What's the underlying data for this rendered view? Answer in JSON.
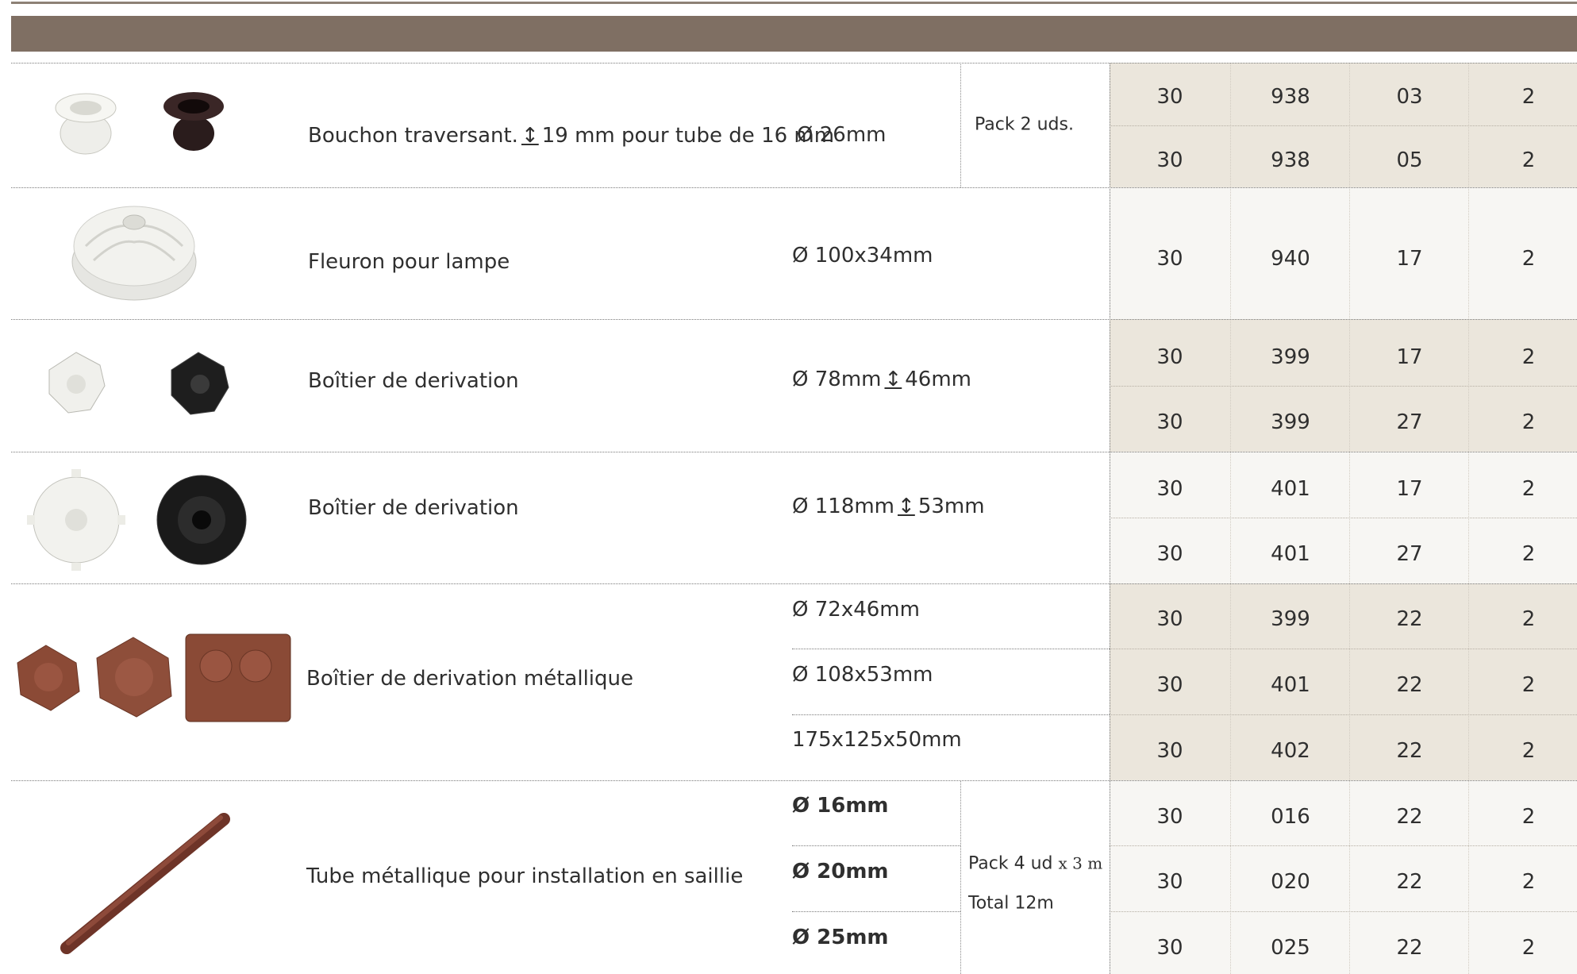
{
  "colors": {
    "band": "#7f6f63",
    "shaded_row": "#ebe6dc"
  },
  "rows": [
    {
      "description": "Bouchon traversant.",
      "height_icon": "height-arrow-icon",
      "description_suffix": "19 mm pour tube de 16 mm",
      "dimension": "Ø 26mm",
      "pack": "Pack 2 uds.",
      "codes": [
        [
          "30",
          "938",
          "03",
          "2"
        ],
        [
          "30",
          "938",
          "05",
          "2"
        ]
      ]
    },
    {
      "description": "Fleuron pour lampe",
      "dimension": "Ø 100x34mm",
      "codes": [
        [
          "30",
          "940",
          "17",
          "2"
        ]
      ]
    },
    {
      "description": "Boîtier de derivation",
      "dimension_prefix": "Ø 78mm",
      "dimension_suffix": "46mm",
      "codes": [
        [
          "30",
          "399",
          "17",
          "2"
        ],
        [
          "30",
          "399",
          "27",
          "2"
        ]
      ]
    },
    {
      "description": "Boîtier de derivation",
      "dimension_prefix": "Ø 118mm",
      "dimension_suffix": "53mm",
      "codes": [
        [
          "30",
          "401",
          "17",
          "2"
        ],
        [
          "30",
          "401",
          "27",
          "2"
        ]
      ]
    },
    {
      "description": "Boîtier de derivation métallique",
      "dimensions": [
        "Ø 72x46mm",
        "Ø 108x53mm",
        "175x125x50mm"
      ],
      "codes": [
        [
          "30",
          "399",
          "22",
          "2"
        ],
        [
          "30",
          "401",
          "22",
          "2"
        ],
        [
          "30",
          "402",
          "22",
          "2"
        ]
      ]
    },
    {
      "description": "Tube métallique pour installation en saillie",
      "dimensions": [
        "Ø 16mm",
        "Ø 20mm",
        "Ø 25mm"
      ],
      "pack_line1": "Pack 4 ud",
      "pack_line1_suffix": "x 3 m",
      "pack_line2": "Total 12m",
      "codes": [
        [
          "30",
          "016",
          "22",
          "2"
        ],
        [
          "30",
          "020",
          "22",
          "2"
        ],
        [
          "30",
          "025",
          "22",
          "2"
        ]
      ]
    }
  ]
}
